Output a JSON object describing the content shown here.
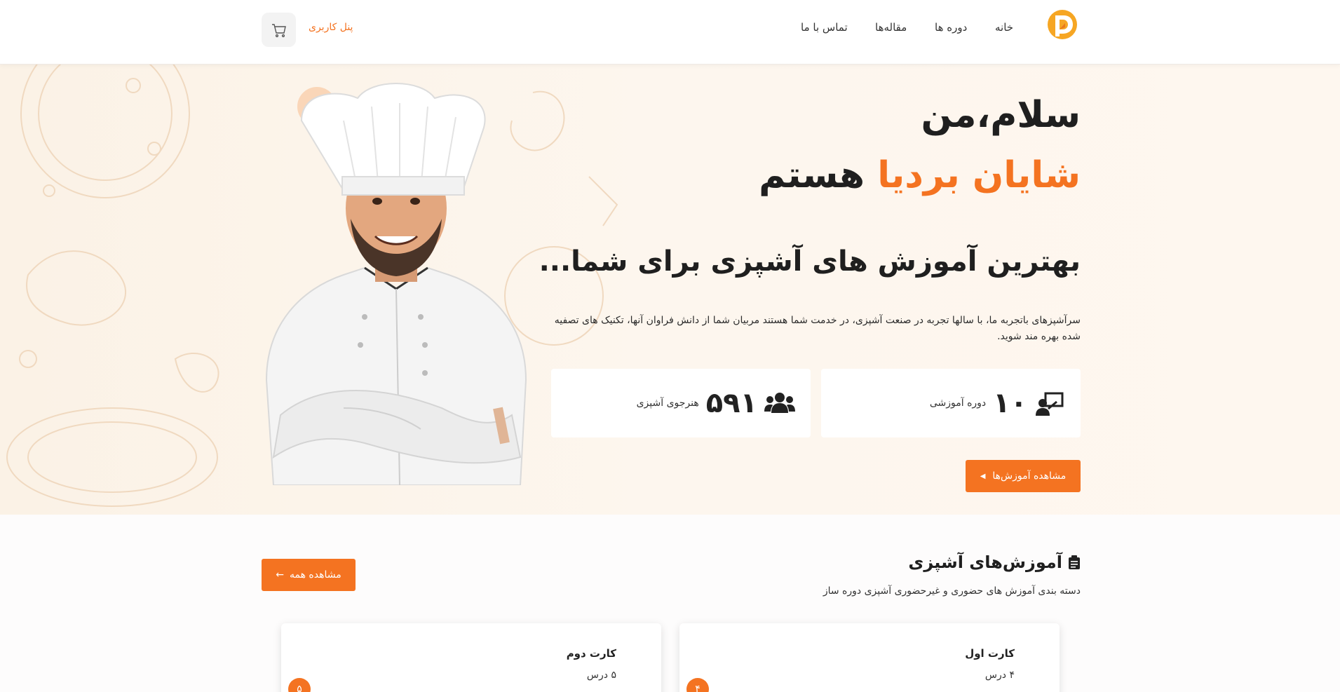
{
  "header": {
    "nav": [
      {
        "label": "خانه"
      },
      {
        "label": "دوره ها"
      },
      {
        "label": "مقاله‌ها"
      },
      {
        "label": "تماس با ما"
      }
    ],
    "user_panel": "پنل کاربری",
    "cart_icon": "cart-icon",
    "logo_icon": "logo-icon"
  },
  "hero": {
    "greeting": "سلام،من",
    "name": "شایان بردیا",
    "name_suffix": " هستم",
    "subtitle": "بهترین آموزش های آشپزی برای شما...",
    "description": "سرآشپزهای باتجربه ما، با سالها تجربه در صنعت آشپزی، در خدمت شما هستند مربیان شما از دانش فراوان آنها، تکنیک های تصفیه شده بهره مند شوید.",
    "stats": [
      {
        "value": "۱۰",
        "label": "دوره آموزشی",
        "icon": "presentation-icon"
      },
      {
        "value": "۵۹۱",
        "label": "هنرجوی آشپزی",
        "icon": "users-icon"
      }
    ],
    "cta_label": "مشاهده آموزش‌ها"
  },
  "courses": {
    "title": "آموزش‌های آشپزی",
    "subtitle": "دسته بندی آموزش های حضوری و غیرحضوری آشپزی دوره ساز",
    "see_all": "مشاهده همه",
    "cards": [
      {
        "title": "کارت اول",
        "lessons": "۴ درس",
        "badge": "۴"
      },
      {
        "title": "کارت دوم",
        "lessons": "۵ درس",
        "badge": "۵"
      }
    ]
  },
  "colors": {
    "accent": "#f47321",
    "hero_bg": "#fdf6ee",
    "text": "#1f1f1f"
  }
}
